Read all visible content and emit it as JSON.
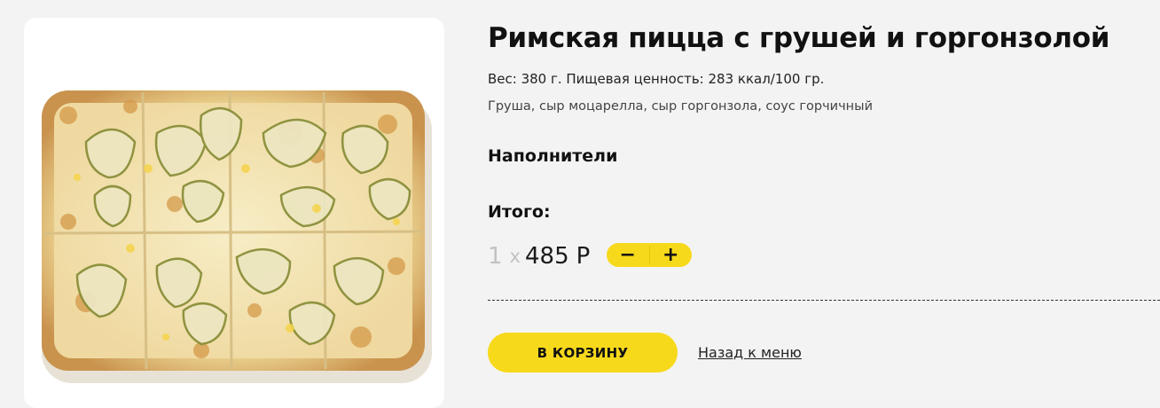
{
  "product": {
    "title": "Римская пицца с грушей и горгонзолой",
    "meta": "Вес: 380 г. Пищевая ценность: 283 ккал/100 гр.",
    "ingredients": "Груша, сыр моцарелла, сыр горгонзола, соус горчичный",
    "image": "pizza-photo"
  },
  "fillers": {
    "label": "Наполнители"
  },
  "total": {
    "label": "Итого:",
    "quantity": "1",
    "times": "x",
    "price": "485",
    "currency": "Р"
  },
  "stepper": {
    "minus": "−",
    "plus": "+"
  },
  "actions": {
    "add_to_cart": "В КОРЗИНУ",
    "back": "Назад к меню"
  },
  "colors": {
    "accent": "#f7d91b",
    "background": "#f3f3f3"
  }
}
